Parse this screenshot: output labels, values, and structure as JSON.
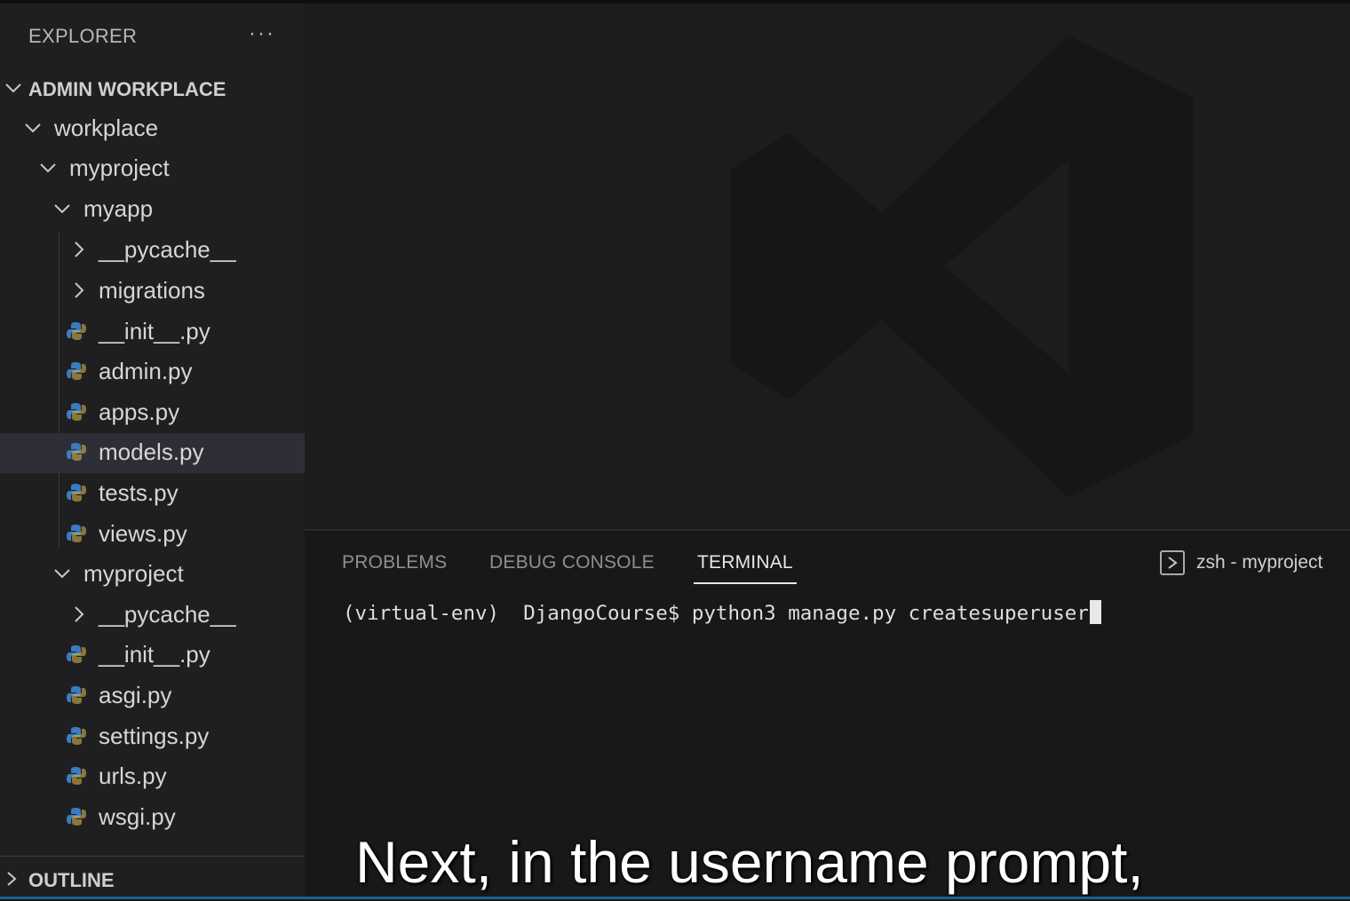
{
  "explorer": {
    "title": "EXPLORER",
    "more": "···"
  },
  "tree": [
    {
      "label": "ADMIN WORKPLACE",
      "kind": "section",
      "expanded": true
    },
    {
      "label": "workplace",
      "kind": "folder",
      "expanded": true
    },
    {
      "label": "myproject",
      "kind": "folder",
      "expanded": true
    },
    {
      "label": "myapp",
      "kind": "folder",
      "expanded": true
    },
    {
      "label": "__pycache__",
      "kind": "folder",
      "expanded": false
    },
    {
      "label": "migrations",
      "kind": "folder",
      "expanded": false
    },
    {
      "label": "__init__.py",
      "kind": "python-file"
    },
    {
      "label": "admin.py",
      "kind": "python-file"
    },
    {
      "label": "apps.py",
      "kind": "python-file"
    },
    {
      "label": "models.py",
      "kind": "python-file",
      "selected": true
    },
    {
      "label": "tests.py",
      "kind": "python-file"
    },
    {
      "label": "views.py",
      "kind": "python-file"
    },
    {
      "label": "myproject",
      "kind": "folder",
      "expanded": true
    },
    {
      "label": "__pycache__",
      "kind": "folder",
      "expanded": false
    },
    {
      "label": "__init__.py",
      "kind": "python-file"
    },
    {
      "label": "asgi.py",
      "kind": "python-file"
    },
    {
      "label": "settings.py",
      "kind": "python-file"
    },
    {
      "label": "urls.py",
      "kind": "python-file"
    },
    {
      "label": "wsgi.py",
      "kind": "python-file"
    }
  ],
  "outline": {
    "label": "OUTLINE"
  },
  "panel": {
    "tabs": [
      {
        "label": "PROBLEMS"
      },
      {
        "label": "DEBUG CONSOLE"
      },
      {
        "label": "TERMINAL",
        "active": true
      }
    ],
    "terminal_name": "zsh - myproject",
    "terminal_line": "(virtual-env)  DjangoCourse$ python3 manage.py createsuperuser"
  },
  "caption": "Next, in the username prompt,",
  "colors": {
    "sidebar_bg": "#1f1f21",
    "editor_bg": "#1c1c1c",
    "python_blue": "#3b7bbf",
    "python_yellow": "#e0c050"
  }
}
